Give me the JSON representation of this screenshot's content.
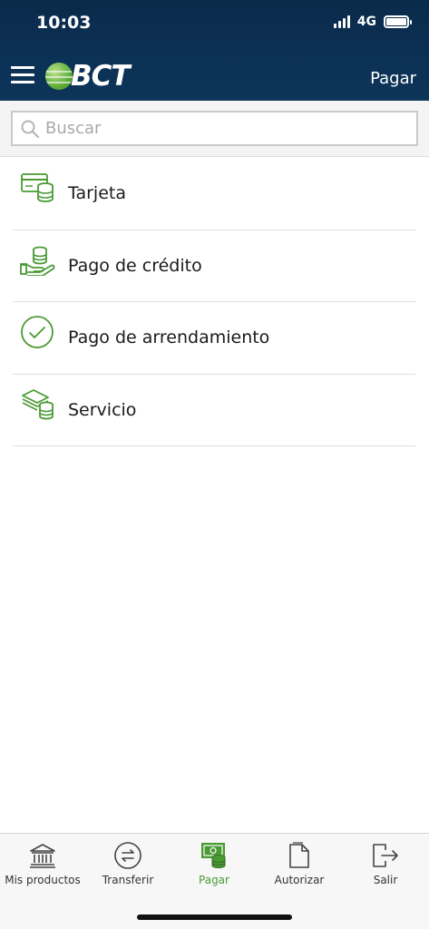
{
  "status_bar": {
    "time": "10:03",
    "network": "4G"
  },
  "header": {
    "logo_text": "BCT",
    "title": "Pagar"
  },
  "search": {
    "placeholder": "Buscar",
    "value": ""
  },
  "payment_options": [
    {
      "label": "Tarjeta",
      "icon": "card-coins-icon"
    },
    {
      "label": "Pago de crédito",
      "icon": "hand-coins-icon"
    },
    {
      "label": "Pago de arrendamiento",
      "icon": "check-circle-icon"
    },
    {
      "label": "Servicio",
      "icon": "bills-coins-icon"
    }
  ],
  "tabs": [
    {
      "label": "Mis productos",
      "icon": "bank-icon",
      "active": false
    },
    {
      "label": "Transferir",
      "icon": "transfer-icon",
      "active": false
    },
    {
      "label": "Pagar",
      "icon": "pay-icon",
      "active": true
    },
    {
      "label": "Autorizar",
      "icon": "document-icon",
      "active": false
    },
    {
      "label": "Salir",
      "icon": "logout-icon",
      "active": false
    }
  ],
  "colors": {
    "header_bg": "#0c3156",
    "accent_green": "#4a9a34",
    "divider": "#dedede"
  }
}
